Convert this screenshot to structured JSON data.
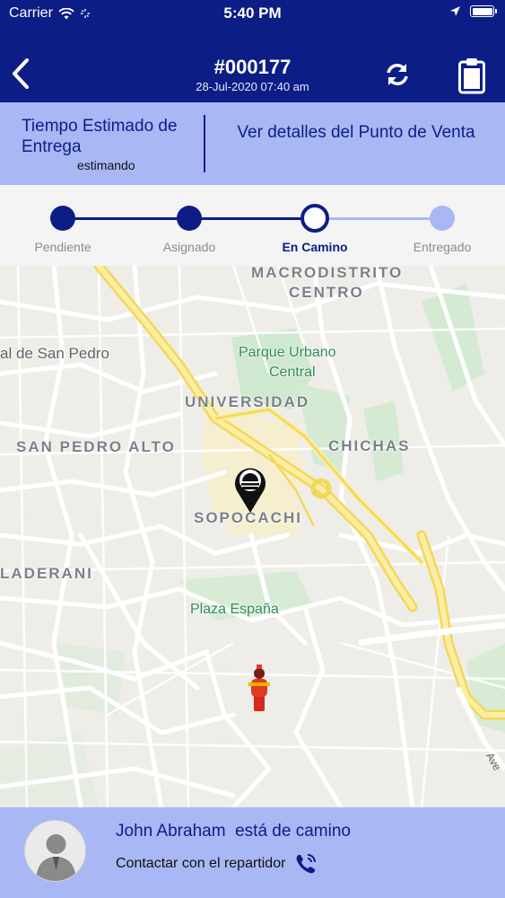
{
  "status_bar": {
    "carrier": "Carrier",
    "time": "5:40 PM"
  },
  "header": {
    "order_number": "#000177",
    "order_date": "28-Jul-2020 07:40 am"
  },
  "info": {
    "eta_title": "Tiempo Estimado de Entrega",
    "eta_status": "estimando",
    "pdv_label": "Ver detalles del Punto de Venta"
  },
  "steps": [
    {
      "label": "Pendiente",
      "state": "done"
    },
    {
      "label": "Asignado",
      "state": "done"
    },
    {
      "label": "En Camino",
      "state": "current"
    },
    {
      "label": "Entregado",
      "state": "pending"
    }
  ],
  "map": {
    "labels": {
      "macrodistrito": "MACRODISTRITO",
      "centro": "CENTRO",
      "san_pedro": "al de San Pedro",
      "parque": "Parque Urbano",
      "parque2": "Central",
      "universidad": "UNIVERSIDAD",
      "san_pedro_alto": "SAN PEDRO ALTO",
      "chichas": "CHICHAS",
      "sopocachi": "SOPOCACHI",
      "laderani": "LADERANI",
      "plaza": "Plaza España",
      "ave": "Ave"
    }
  },
  "footer": {
    "driver_name": "John Abraham",
    "driver_status": "está de camino",
    "contact_label": "Contactar con el repartidor"
  },
  "colors": {
    "primary": "#0c1d86",
    "accent": "#a9b7f5",
    "road_major": "#f6e27a"
  }
}
